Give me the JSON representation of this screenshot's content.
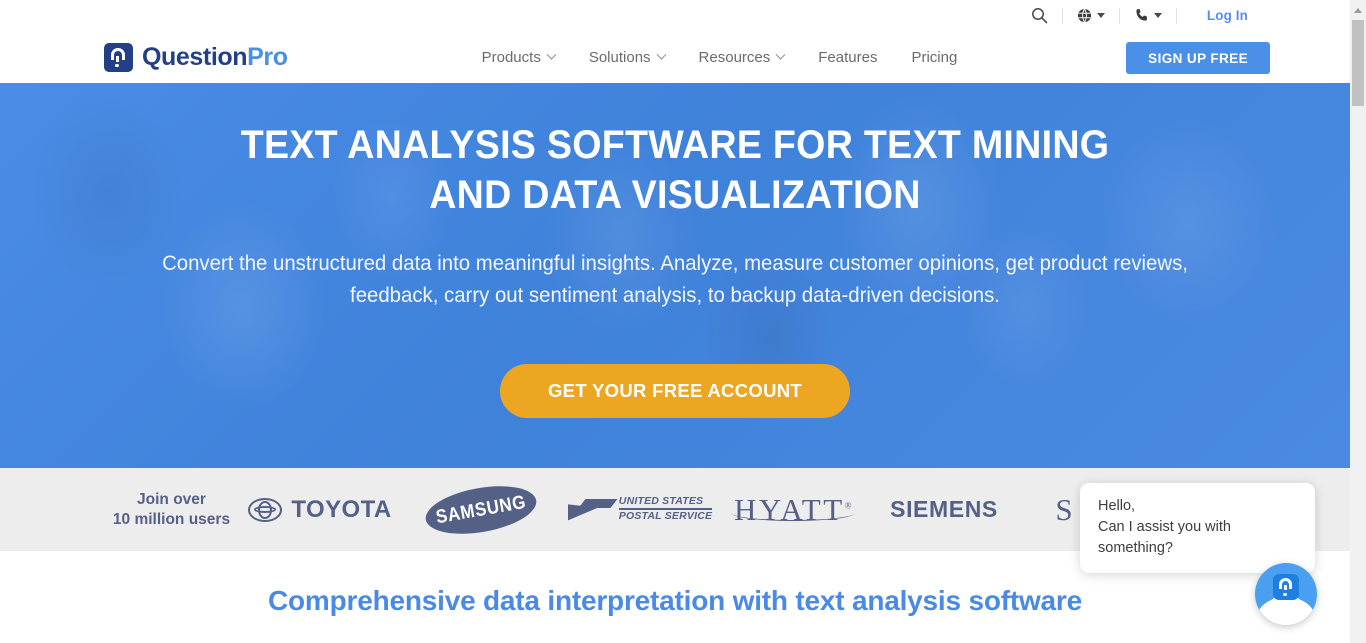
{
  "utility_bar": {
    "search_icon": "search-icon",
    "language_icon": "globe-icon",
    "phone_icon": "phone-icon",
    "login_label": "Log In"
  },
  "header": {
    "brand_primary": "Question",
    "brand_secondary": "Pro",
    "nav": [
      {
        "label": "Products",
        "has_dropdown": true
      },
      {
        "label": "Solutions",
        "has_dropdown": true
      },
      {
        "label": "Resources",
        "has_dropdown": true
      },
      {
        "label": "Features",
        "has_dropdown": false
      },
      {
        "label": "Pricing",
        "has_dropdown": false
      }
    ],
    "signup_label": "SIGN UP FREE"
  },
  "hero": {
    "title": "TEXT ANALYSIS SOFTWARE FOR TEXT MINING AND DATA VISUALIZATION",
    "subtitle": "Convert the unstructured data into meaningful insights. Analyze, measure customer opinions, get product reviews, feedback, carry out sentiment analysis, to backup data-driven decisions.",
    "cta_label": "GET YOUR FREE ACCOUNT",
    "background_color": "#4285dc",
    "cta_color": "#eda621"
  },
  "logo_strip": {
    "join_line1": "Join over",
    "join_line2": "10 million users",
    "logo_color": "#556087",
    "background_color": "#ededed",
    "logos": [
      {
        "name": "Toyota",
        "word": "TOYOTA"
      },
      {
        "name": "Samsung",
        "word": "SAMSUNG"
      },
      {
        "name": "United States Postal Service",
        "line1": "UNITED STATES",
        "line2": "POSTAL SERVICE"
      },
      {
        "name": "Hyatt",
        "word": "HYATT",
        "mark": "®"
      },
      {
        "name": "Siemens",
        "word": "SIEMENS"
      },
      {
        "name": "Partially hidden logo",
        "word": "S"
      }
    ]
  },
  "section_below": {
    "heading": "Comprehensive data interpretation with text analysis software",
    "heading_color": "#4a8ae6"
  },
  "chat_widget": {
    "greeting": "Hello,",
    "message": "Can I assist you with something?",
    "avatar_icon": "questionpro-agent-avatar-icon"
  },
  "scrollbar": {
    "thumb_color": "#c1c1c1",
    "track_color": "#f1f1f1"
  }
}
